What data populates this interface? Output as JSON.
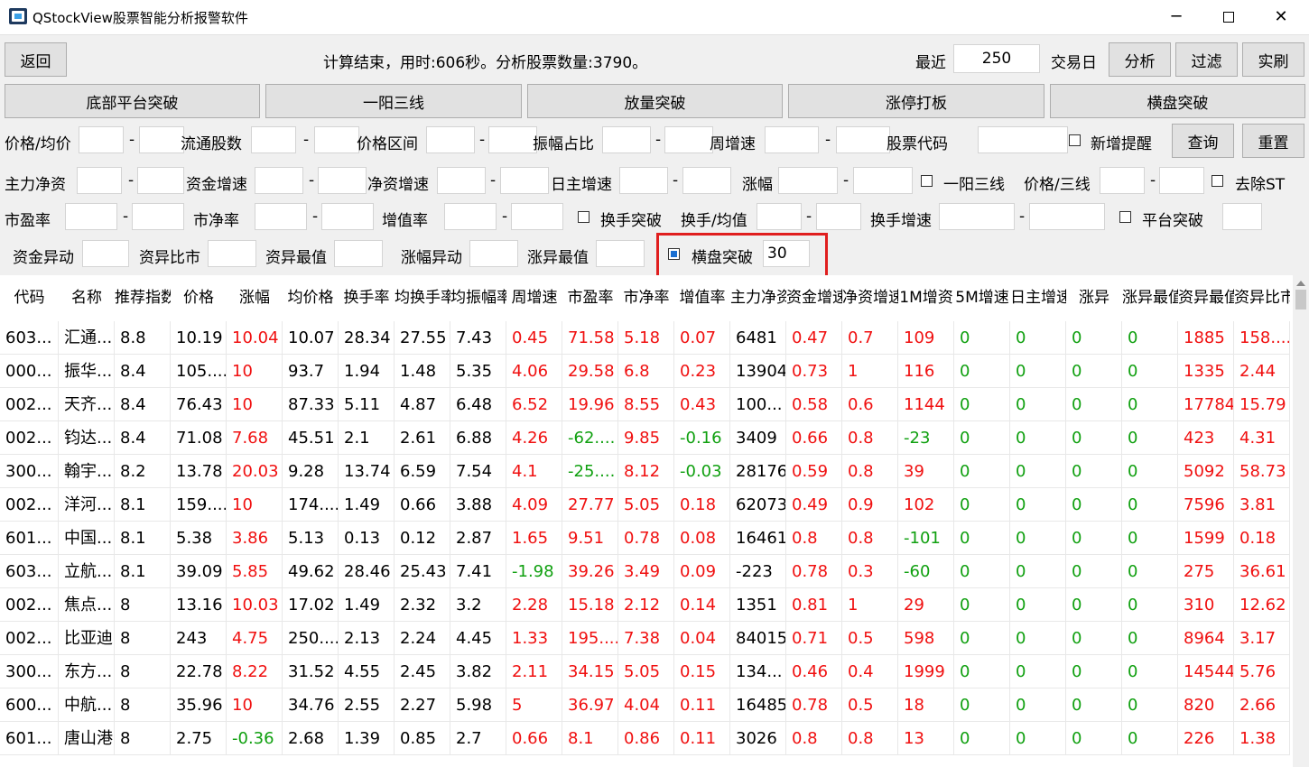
{
  "window": {
    "title": "QStockView股票智能分析报警软件",
    "min": "─",
    "close": "✕"
  },
  "toolbar": {
    "back": "返回",
    "status": "计算结束，用时:606秒。分析股票数量:3790。",
    "recent_label": "最近",
    "recent_value": "250",
    "days_label": "交易日",
    "analyze": "分析",
    "filter": "过滤",
    "realtime": "实刷"
  },
  "strategies": [
    "底部平台突破",
    "一阳三线",
    "放量突破",
    "涨停打板",
    "横盘突破"
  ],
  "filters": {
    "price_avg": "价格/均价",
    "float_shares": "流通股数",
    "price_range": "价格区间",
    "amplitude_ratio": "振幅占比",
    "weekly_growth": "周增速",
    "stock_code": "股票代码",
    "new_alert": "新增提醒",
    "query": "查询",
    "reset": "重置",
    "main_net": "主力净资",
    "fund_growth": "资金增速",
    "net_growth": "净资增速",
    "daily_main_growth": "日主增速",
    "change": "涨幅",
    "one_yang": "一阳三线",
    "price_3line": "价格/三线",
    "exclude_st": "去除ST",
    "pe": "市盈率",
    "pb": "市净率",
    "value_growth": "增值率",
    "turnover_break": "换手突破",
    "turnover_avg": "换手/均值",
    "turnover_growth": "换手增速",
    "platform_break": "平台突破",
    "fund_anomaly": "资金异动",
    "fund_anomaly_ratio": "资异比市",
    "fund_anomaly_max": "资异最值",
    "change_anomaly": "涨幅异动",
    "change_anomaly_max": "涨异最值",
    "sideways_break": "横盘突破",
    "sideways_value": "30"
  },
  "table": {
    "headers": [
      "代码",
      "名称",
      "推荐指数",
      "价格",
      "涨幅",
      "均价格",
      "换手率",
      "均换手率",
      "均振幅率",
      "周增速",
      "市盈率",
      "市净率",
      "增值率",
      "主力净资",
      "资金增速",
      "净资增速",
      "1M增资",
      "5M增速",
      "日主增速",
      "涨异",
      "涨异最值",
      "资异最值",
      "资异比市"
    ],
    "rows": [
      [
        "603...",
        "汇通...",
        "8.8",
        "10.19",
        "10.04",
        "10.07",
        "28.34",
        "27.55",
        "7.43",
        "0.45",
        "71.58",
        "5.18",
        "0.07",
        "6481",
        "0.47",
        "0.7",
        "109",
        "0",
        "0",
        "0",
        "0",
        "1885",
        "158...."
      ],
      [
        "000...",
        "振华...",
        "8.4",
        "105....",
        "10",
        "93.7",
        "1.94",
        "1.48",
        "5.35",
        "4.06",
        "29.58",
        "6.8",
        "0.23",
        "13904",
        "0.73",
        "1",
        "116",
        "0",
        "0",
        "0",
        "0",
        "1335",
        "2.44"
      ],
      [
        "002...",
        "天齐...",
        "8.4",
        "76.43",
        "10",
        "87.33",
        "5.11",
        "4.87",
        "6.48",
        "6.52",
        "19.96",
        "8.55",
        "0.43",
        "100...",
        "0.58",
        "0.6",
        "1144",
        "0",
        "0",
        "0",
        "0",
        "17784",
        "15.79"
      ],
      [
        "002...",
        "钧达...",
        "8.4",
        "71.08",
        "7.68",
        "45.51",
        "2.1",
        "2.61",
        "6.88",
        "4.26",
        "-62....",
        "9.85",
        "-0.16",
        "3409",
        "0.66",
        "0.8",
        "-23",
        "0",
        "0",
        "0",
        "0",
        "423",
        "4.31"
      ],
      [
        "300...",
        "翰宇...",
        "8.2",
        "13.78",
        "20.03",
        "9.28",
        "13.74",
        "6.59",
        "7.54",
        "4.1",
        "-25....",
        "8.12",
        "-0.03",
        "28176",
        "0.59",
        "0.8",
        "39",
        "0",
        "0",
        "0",
        "0",
        "5092",
        "58.73"
      ],
      [
        "002...",
        "洋河...",
        "8.1",
        "159....",
        "10",
        "174....",
        "1.49",
        "0.66",
        "3.88",
        "4.09",
        "27.77",
        "5.05",
        "0.18",
        "62073",
        "0.49",
        "0.9",
        "102",
        "0",
        "0",
        "0",
        "0",
        "7596",
        "3.81"
      ],
      [
        "601...",
        "中国...",
        "8.1",
        "5.38",
        "3.86",
        "5.13",
        "0.13",
        "0.12",
        "2.87",
        "1.65",
        "9.51",
        "0.78",
        "0.08",
        "16461",
        "0.8",
        "0.8",
        "-101",
        "0",
        "0",
        "0",
        "0",
        "1599",
        "0.18"
      ],
      [
        "603...",
        "立航...",
        "8.1",
        "39.09",
        "5.85",
        "49.62",
        "28.46",
        "25.43",
        "7.41",
        "-1.98",
        "39.26",
        "3.49",
        "0.09",
        "-223",
        "0.78",
        "0.3",
        "-60",
        "0",
        "0",
        "0",
        "0",
        "275",
        "36.61"
      ],
      [
        "002...",
        "焦点...",
        "8",
        "13.16",
        "10.03",
        "17.02",
        "1.49",
        "2.32",
        "3.2",
        "2.28",
        "15.18",
        "2.12",
        "0.14",
        "1351",
        "0.81",
        "1",
        "29",
        "0",
        "0",
        "0",
        "0",
        "310",
        "12.62"
      ],
      [
        "002...",
        "比亚迪",
        "8",
        "243",
        "4.75",
        "250....",
        "2.13",
        "2.24",
        "4.45",
        "1.33",
        "195....",
        "7.38",
        "0.04",
        "84015",
        "0.71",
        "0.5",
        "598",
        "0",
        "0",
        "0",
        "0",
        "8964",
        "3.17"
      ],
      [
        "300...",
        "东方...",
        "8",
        "22.78",
        "8.22",
        "31.52",
        "4.55",
        "2.45",
        "3.82",
        "2.11",
        "34.15",
        "5.05",
        "0.15",
        "134...",
        "0.46",
        "0.4",
        "1999",
        "0",
        "0",
        "0",
        "0",
        "14544",
        "5.76"
      ],
      [
        "600...",
        "中航...",
        "8",
        "35.96",
        "10",
        "34.76",
        "2.55",
        "2.27",
        "5.98",
        "5",
        "36.97",
        "4.04",
        "0.11",
        "16485",
        "0.78",
        "0.5",
        "18",
        "0",
        "0",
        "0",
        "0",
        "820",
        "2.66"
      ],
      [
        "601...",
        "唐山港",
        "8",
        "2.75",
        "-0.36",
        "2.68",
        "1.39",
        "0.85",
        "2.7",
        "0.66",
        "8.1",
        "0.86",
        "0.11",
        "3026",
        "0.8",
        "0.8",
        "13",
        "0",
        "0",
        "0",
        "0",
        "226",
        "1.38"
      ]
    ]
  },
  "colors": {
    "red": "#f01010",
    "green": "#10a010",
    "highlight": "#e01e1e",
    "checkbox": "#1a6fd1"
  }
}
